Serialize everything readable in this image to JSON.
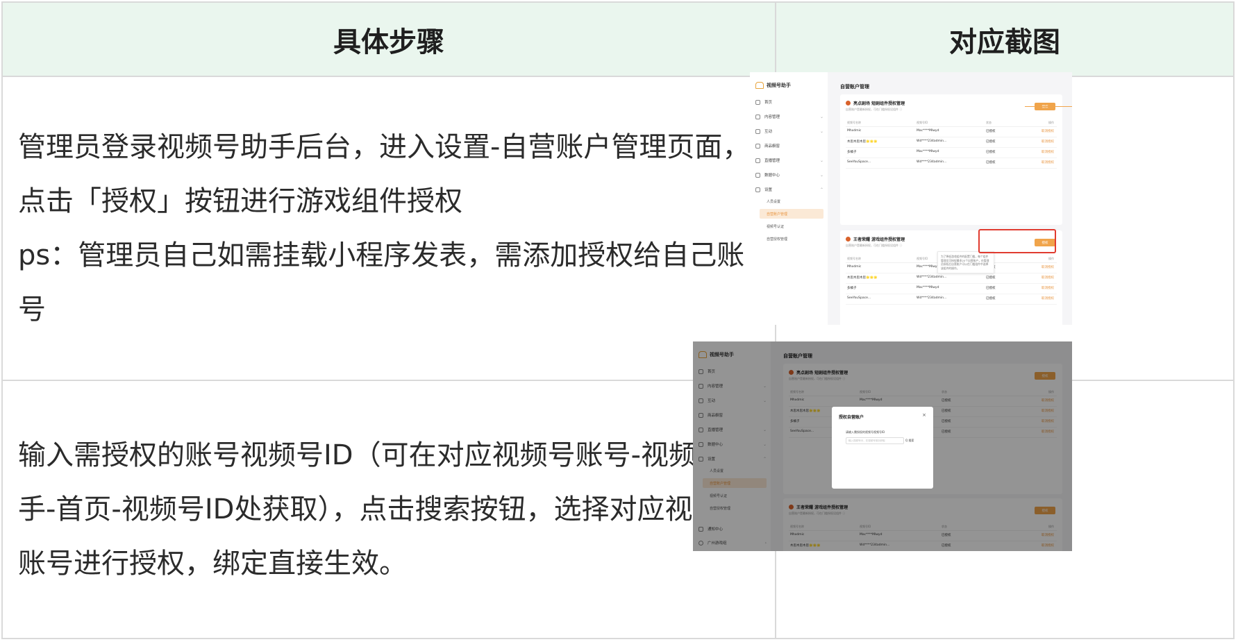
{
  "table": {
    "headers": [
      "具体步骤",
      "对应截图"
    ],
    "rows": [
      {
        "step_lines": [
          "管理员登录视频号助手后台，进入设置-自营账户管理页面，",
          "点击「授权」按钮进行游戏组件授权",
          "ps：管理员自己如需挂载小程序发表，需添加授权给自己账",
          "号"
        ]
      },
      {
        "step_lines": [
          "输入需授权的账号视频号ID（可在对应视频号账号-视频号助",
          "手-首页-视频号ID处获取），点击搜索按钮，选择对应视频号",
          "账号进行授权，绑定直接生效。"
        ]
      }
    ]
  },
  "screenshot": {
    "app_name": "视频号助手",
    "nav": [
      "首页",
      "内容管理",
      "互动",
      "商品橱窗",
      "直播管理",
      "数据中心",
      "设置"
    ],
    "nav_extra": [
      "通知中心",
      "广州游戏组"
    ],
    "settings_sub": [
      "人员设置",
      "自营账户管理",
      "视频号认证",
      "自营授权管理"
    ],
    "page_title": "自营账户管理",
    "card1": {
      "title": "亮点剧场 短剧组件授权管理",
      "subtitle": "自营账户是最新授权，可在门槛授权设组件 ⓘ"
    },
    "card2": {
      "title": "王者荣耀 游戏组件授权管理",
      "subtitle": "自营账户是最新授权，可在门槛授权设组件 ⓘ"
    },
    "auth_button": "授权",
    "columns": [
      "视频号名称",
      "视频号ID",
      "状态",
      "操作"
    ],
    "accounts": [
      {
        "name": "Mhxdmic",
        "id": "Mac****Mlwyd",
        "status": "已授权",
        "action": "取消授权"
      },
      {
        "name": "木思木思木思🌟🌟🌟",
        "id": "Wd****234admin...",
        "status": "已授权",
        "action": "取消授权"
      },
      {
        "name": "多橘子",
        "id": "Mac****Mlwyd",
        "status": "已授权",
        "action": "取消授权"
      },
      {
        "name": "SeeYouSpace...",
        "id": "Wd****234admin...",
        "status": "已授权",
        "action": "取消授权"
      }
    ],
    "tooltip": "为了降低游戏组件的配置门槛，每个组件管理员可授权最多20个自营账户，在管理员授权后自营账户可以在门槛组件中选择该组件的操作。",
    "modal": {
      "title": "授权自营账户",
      "close": "×",
      "label": "请输入需授权的视频号视频号ID",
      "placeholder": "输入视频号ID，在视频号首页获取",
      "search": "Q 搜索"
    }
  }
}
